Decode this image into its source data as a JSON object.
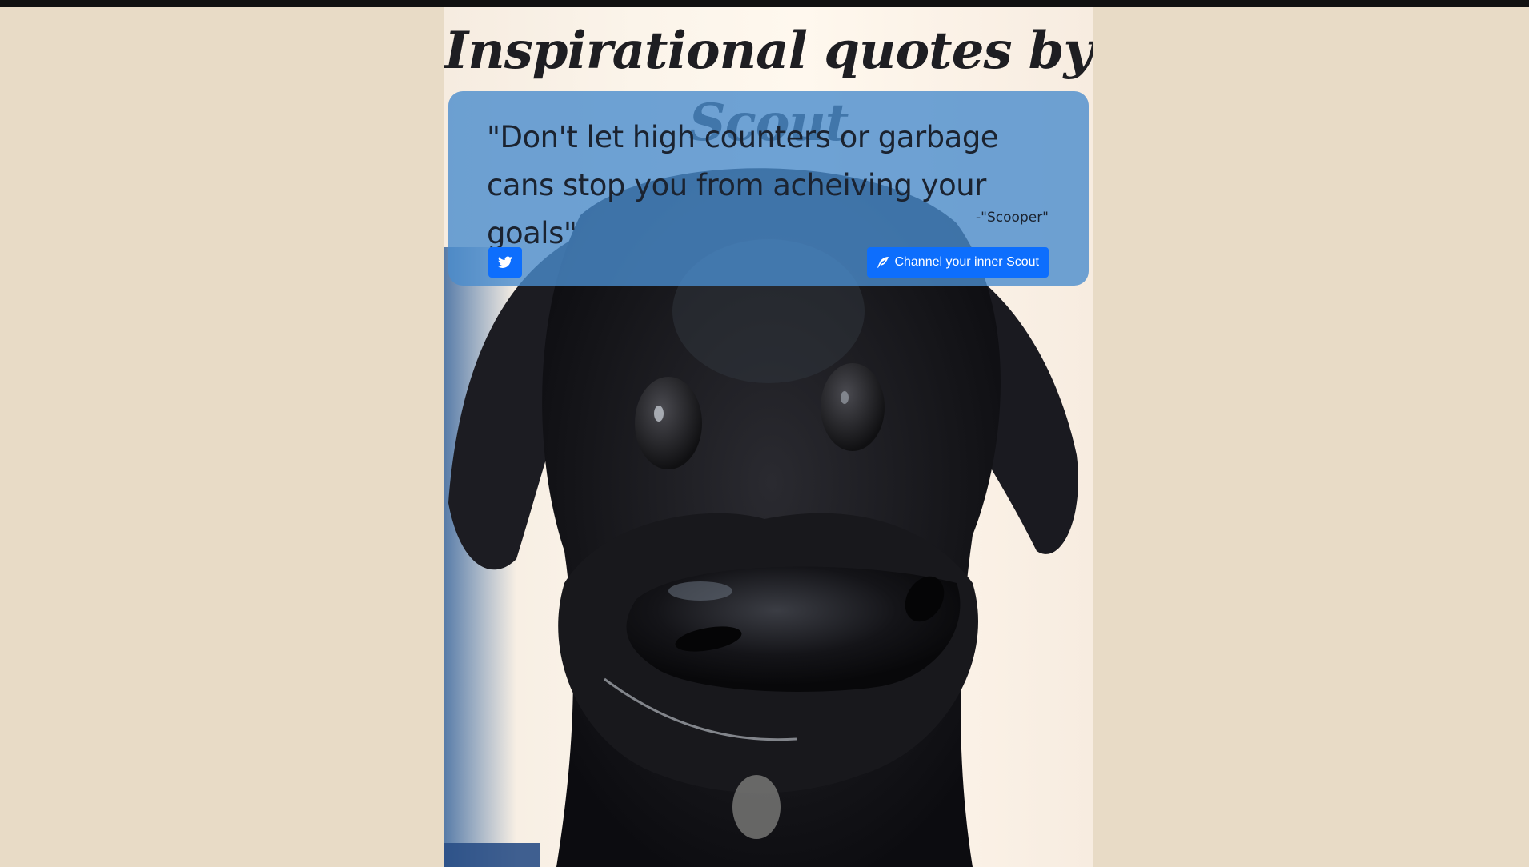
{
  "page": {
    "title": "Inspirational quotes by Scout"
  },
  "quote": {
    "text": "\"Don't let high counters or garbage cans stop you from acheiving your goals\"",
    "author": "-\"Scooper\""
  },
  "buttons": {
    "tweet_icon": "twitter-icon",
    "new_quote_label": "Channel your inner Scout",
    "new_quote_icon": "feather-icon"
  },
  "colors": {
    "background": "#e8dbc6",
    "quote_box": "#4a8ccd",
    "button": "#0d6efd",
    "title_text": "#1e1e22"
  }
}
